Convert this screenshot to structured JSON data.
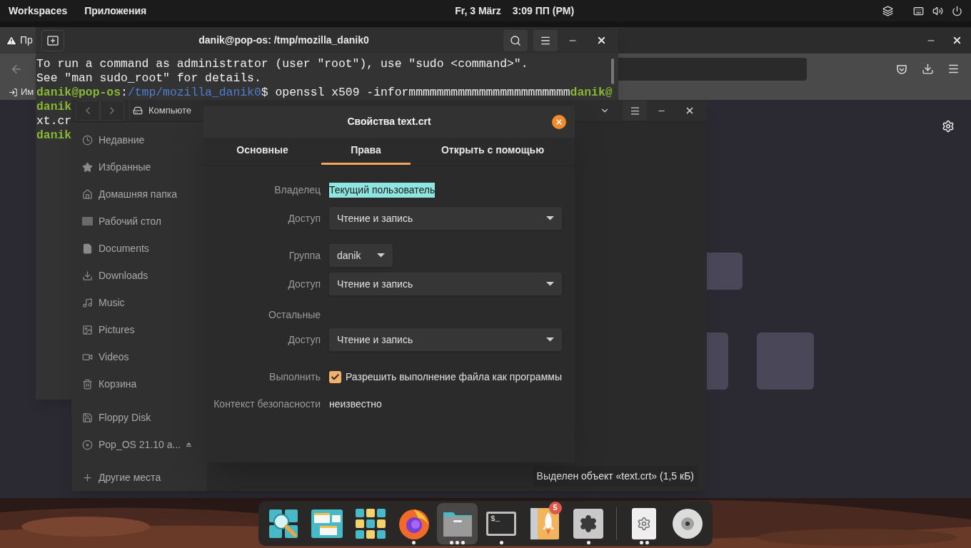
{
  "top_bar": {
    "workspaces": "Workspaces",
    "apps": "Приложения",
    "date": "Fr, 3 März",
    "time": "3:09 ПП (PM)"
  },
  "browser": {
    "tab_label": "Пр",
    "bookmark": "Им"
  },
  "terminal": {
    "title": "danik@pop-os: /tmp/mozilla_danik0",
    "lines": [
      [
        {
          "kind": "text",
          "t": "To run a command as administrator (user \"root\"), use \"sudo <command>\"."
        }
      ],
      [
        {
          "kind": "text",
          "t": "See \"man sudo_root\" for details."
        }
      ],
      [
        {
          "kind": "user",
          "t": "danik@pop-os"
        },
        {
          "kind": "text",
          "t": ":"
        },
        {
          "kind": "path",
          "t": "/tmp/mozilla_danik0"
        },
        {
          "kind": "text",
          "t": "$ openssl x509 -informmmmmmmmmmmmmmmmmmmmmmm"
        },
        {
          "kind": "user",
          "t": "danik@"
        }
      ],
      [
        {
          "kind": "user",
          "t": "danik"
        }
      ],
      [
        {
          "kind": "text",
          "t": "xt.cr"
        }
      ],
      [
        {
          "kind": "user",
          "t": "danik"
        }
      ]
    ]
  },
  "file_manager": {
    "path": "Компьюте",
    "sidebar": [
      {
        "kind": "recent",
        "label": "Недавние"
      },
      {
        "kind": "starred",
        "label": "Избранные"
      },
      {
        "kind": "home",
        "label": "Домашняя папка"
      },
      {
        "kind": "desktop",
        "label": "Рабочий стол"
      },
      {
        "kind": "documents",
        "label": "Documents"
      },
      {
        "kind": "downloads",
        "label": "Downloads"
      },
      {
        "kind": "music",
        "label": "Music"
      },
      {
        "kind": "pictures",
        "label": "Pictures"
      },
      {
        "kind": "videos",
        "label": "Videos"
      },
      {
        "kind": "trash",
        "label": "Корзина"
      },
      {
        "kind": "floppy",
        "label": "Floppy Disk"
      },
      {
        "kind": "disc",
        "label": "Pop_OS 21.10 a...",
        "eject": true
      },
      {
        "kind": "other",
        "label": "Другие места"
      }
    ],
    "status": "Выделен объект «text.crt» (1,5 кБ)"
  },
  "dialog": {
    "title": "Свойства text.crt",
    "tabs": [
      {
        "label": "Основные",
        "selected": false
      },
      {
        "label": "Права",
        "selected": true
      },
      {
        "label": "Открыть с помощью",
        "selected": false
      }
    ],
    "rows": [
      {
        "kind": "owner",
        "label": "Владелец",
        "value": "Текущий пользователь",
        "highlighted": true
      },
      {
        "kind": "access",
        "label": "Доступ",
        "value": "Чтение и запись"
      },
      {
        "kind": "group",
        "label": "Группа",
        "value": "danik"
      },
      {
        "kind": "access",
        "label": "Доступ",
        "value": "Чтение и запись"
      },
      {
        "kind": "section",
        "label": "Остальные"
      },
      {
        "kind": "access",
        "label": "Доступ",
        "value": "Чтение и запись"
      },
      {
        "kind": "checkbox",
        "label": "Выполнить",
        "value": "Разрешить выполнение файла как программы",
        "checked": true
      },
      {
        "kind": "info",
        "label": "Контекст безопасности",
        "value": "неизвестно"
      }
    ]
  },
  "dock": [
    {
      "kind": "search"
    },
    {
      "kind": "windows"
    },
    {
      "kind": "grid"
    },
    {
      "kind": "browser",
      "windows": [
        {
          "kind": "window"
        }
      ]
    },
    {
      "kind": "files",
      "selected": true,
      "windows": [
        {
          "kind": "window"
        },
        {
          "kind": "window"
        },
        {
          "kind": "window"
        }
      ]
    },
    {
      "kind": "terminal",
      "glyph": "$_",
      "windows": [
        {
          "kind": "window"
        }
      ]
    },
    {
      "kind": "launcher",
      "badge": "5"
    },
    {
      "kind": "settings",
      "windows": [
        {
          "kind": "window"
        }
      ]
    },
    {
      "kind": "separator"
    },
    {
      "kind": "file-settings",
      "windows": [
        {
          "kind": "window"
        },
        {
          "kind": "window"
        }
      ]
    },
    {
      "kind": "disc"
    }
  ]
}
